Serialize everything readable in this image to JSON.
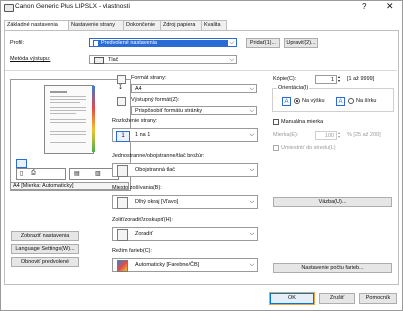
{
  "window": {
    "title": "Canon Generic Plus LIPSLX - vlastnosti",
    "help_glyph": "?",
    "close_glyph": "✕"
  },
  "tabs": [
    "Základné nastavenia",
    "Nastavenie strany",
    "Dokončenie",
    "Zdroj papiera",
    "Kvalita"
  ],
  "profile": {
    "label": "Profil:",
    "value": "Predvolené nastavenia",
    "add_button": "Pridať(1)...",
    "edit_button": "Upraviť(2)..."
  },
  "output": {
    "label": "Metóda výstupu:",
    "value": "Tlač"
  },
  "preview": {
    "caption": "A4 [Mierka: Automaticky]"
  },
  "left_buttons": {
    "show_settings": "Zobraziť nastavenia",
    "language": "Language Settings(W)...",
    "restore": "Obnoviť predvolené"
  },
  "page_format": {
    "label": "Formát strany:",
    "value": "A4"
  },
  "output_format": {
    "label": "Výstupný formát(Z):",
    "value": "Prispôsobiť formátu stránky"
  },
  "page_layout": {
    "label": "Rozloženie strany:",
    "value": "1 na 1"
  },
  "copies": {
    "label": "Kópie(C):",
    "value": "1",
    "range": "[1 až 9999]"
  },
  "orientation": {
    "label": "Orientácia(I)",
    "portrait": "Na výšku",
    "landscape": "Na šírku"
  },
  "manual_scale": {
    "label": "Manuálna mierka",
    "scale_label": "Mierka(E):",
    "scale_value": "100",
    "scale_range": "% [25 až 200]",
    "center_label": "Umiestniť do stredu(L)"
  },
  "duplex": {
    "label": "Jednostranne/obojstranne/tlač brožúr:",
    "value": "Obojstranná tlač"
  },
  "binding": {
    "label": "Miesto zošívania(B):",
    "value": "Dlhý okraj [Vľavo]",
    "button": "Väzba(U)..."
  },
  "collate": {
    "label": "Zoliť/zoradiť/zoskupiť(H):",
    "value": "Zoradiť"
  },
  "color": {
    "label": "Režim farieb(C):",
    "value": "Automaticky [Farebne/ČB]",
    "button": "Nastavenie počtu farieb..."
  },
  "footer": {
    "ok": "OK",
    "cancel": "Zrušiť",
    "help": "Pomocník"
  }
}
